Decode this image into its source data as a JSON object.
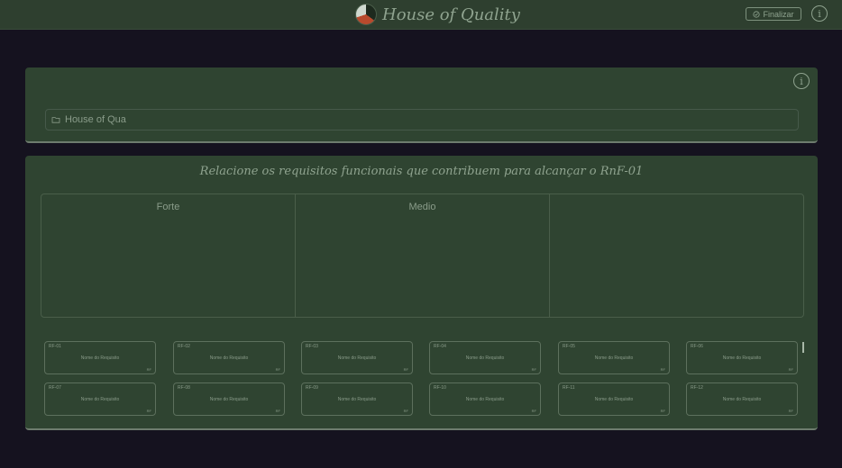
{
  "app": {
    "title": "House of Quality",
    "finalize_label": "Finalizar",
    "info_glyph": "i"
  },
  "document_panel": {
    "field_value": "House of Qua",
    "info_glyph": "i"
  },
  "relation_panel": {
    "instruction": "Relacione os requisitos funcionais que contribuem para alcançar o RnF-01",
    "columns": [
      {
        "label": "Forte"
      },
      {
        "label": "Medio"
      },
      {
        "label": ""
      }
    ],
    "cards": [
      {
        "id": "RF-01",
        "name": "Nome do Requisito",
        "tag": "RF"
      },
      {
        "id": "RF-02",
        "name": "Nome do Requisito",
        "tag": "RF"
      },
      {
        "id": "RF-03",
        "name": "Nome do Requisito",
        "tag": "RF"
      },
      {
        "id": "RF-04",
        "name": "Nome do Requisito",
        "tag": "RF"
      },
      {
        "id": "RF-05",
        "name": "Nome do Requisito",
        "tag": "RF"
      },
      {
        "id": "RF-06",
        "name": "Nome do Requisito",
        "tag": "RF"
      },
      {
        "id": "RF-07",
        "name": "Nome do Requisito",
        "tag": "RF"
      },
      {
        "id": "RF-08",
        "name": "Nome do Requisito",
        "tag": "RF"
      },
      {
        "id": "RF-09",
        "name": "Nome do Requisito",
        "tag": "RF"
      },
      {
        "id": "RF-10",
        "name": "Nome do Requisito",
        "tag": "RF"
      },
      {
        "id": "RF-11",
        "name": "Nome do Requisito",
        "tag": "RF"
      },
      {
        "id": "RF-12",
        "name": "Nome do Requisito",
        "tag": "RF"
      }
    ]
  },
  "icons": {
    "logo": "house-of-quality-logo",
    "info": "info-icon",
    "finalize": "check-circle-icon",
    "document": "folder-icon"
  },
  "colors": {
    "background": "#15121f",
    "panel": "#2f4431",
    "topbar": "#2e3f2f",
    "text": "#8fa38f"
  }
}
